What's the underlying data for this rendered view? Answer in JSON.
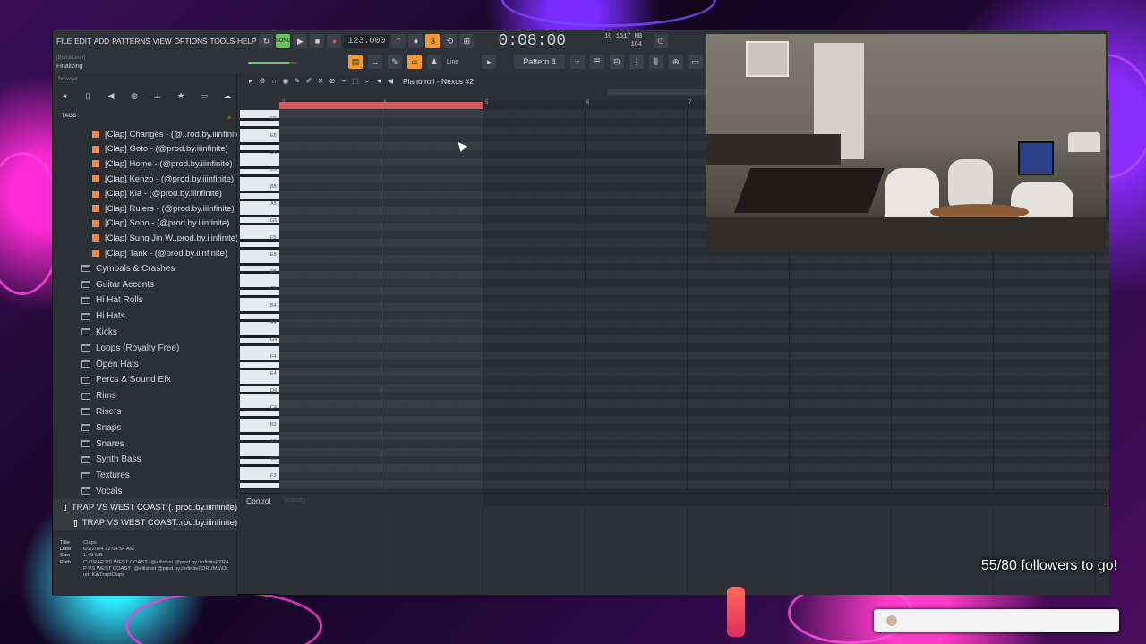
{
  "menu": [
    "FILE",
    "EDIT",
    "ADD",
    "PATTERNS",
    "VIEW",
    "OPTIONS",
    "TOOLS",
    "HELP"
  ],
  "transport": {
    "song_mode": "SONG",
    "tempo": "123.000",
    "clock": "0:08:00",
    "clock_unit": "M:S:CS",
    "cpu": "10",
    "memory": "1517 MB",
    "polyphony": "164"
  },
  "hint": {
    "user": "[BryceLeon]",
    "status": "Finalizing"
  },
  "snap": "Line",
  "pattern": "Pattern 4",
  "browser": {
    "title": "Browser",
    "tags_label": "TAGS",
    "files": [
      "[Clap] Changes - (@..rod.by.iiinfinite)",
      "[Clap] Goto - (@prod.by.iiinfinite)",
      "[Clap] Home - (@prod.by.iiinfinite)",
      "[Clap] Kenzo - (@prod.by.iiinfinite)",
      "[Clap] Kia - (@prod.by.iiinfinite)",
      "[Clap] Rulers - (@prod.by.iiinfinite)",
      "[Clap] Soho - (@prod.by.iiinfinite)",
      "[Clap] Sung Jin W..prod.by.iiinfinite)",
      "[Clap] Tank - (@prod.by.iiinfinite)"
    ],
    "folders": [
      "Cymbals & Crashes",
      "Guitar Accents",
      "Hi Hat Rolls",
      "Hi Hats",
      "Kicks",
      "Loops (Royalty Free)",
      "Open Hats",
      "Percs & Sound Efx",
      "Rims",
      "Risers",
      "Snaps",
      "Snares",
      "Synth Bass",
      "Textures",
      "Vocals"
    ],
    "packs": [
      "TRAP VS WEST COAST (..prod.by.iiinfinite)",
      "TRAP VS WEST COAST..rod.by.iiinfinite)"
    ],
    "info": {
      "title_label": "Title",
      "title": "Claps",
      "date_label": "Date",
      "date": "6/2/2024 12:04:54 AM",
      "size_label": "Size",
      "size": "1.48 MB",
      "path_label": "Path",
      "path": "C:\\TRAP VS WEST COAST (@ellislost @prod.by.iiinfinite)\\TRAP VS WEST COAST (@ellislost @prod.by.iiinfinite)\\DRUMS\\Drum Kit\\Trap\\Claps"
    }
  },
  "piano_roll": {
    "title": "Piano roll - Nexus #2",
    "ruler": [
      "3",
      "4",
      "5",
      "6",
      "7"
    ],
    "key_labels": [
      "F6",
      "E6",
      "D6",
      "C6",
      "B5",
      "A5",
      "G5",
      "F5",
      "E5",
      "D5",
      "C5",
      "B4",
      "A4",
      "G4",
      "F4",
      "E4",
      "D4",
      "C4",
      "B3",
      "A3",
      "G3",
      "F3"
    ],
    "control_label": "Control",
    "control_value": "Velocity"
  },
  "overlay": {
    "followers": "55/80 followers to go!"
  },
  "colors": {
    "accent": "#f49a2c",
    "loop": "#d25b61",
    "clip": "#e88a4a"
  }
}
